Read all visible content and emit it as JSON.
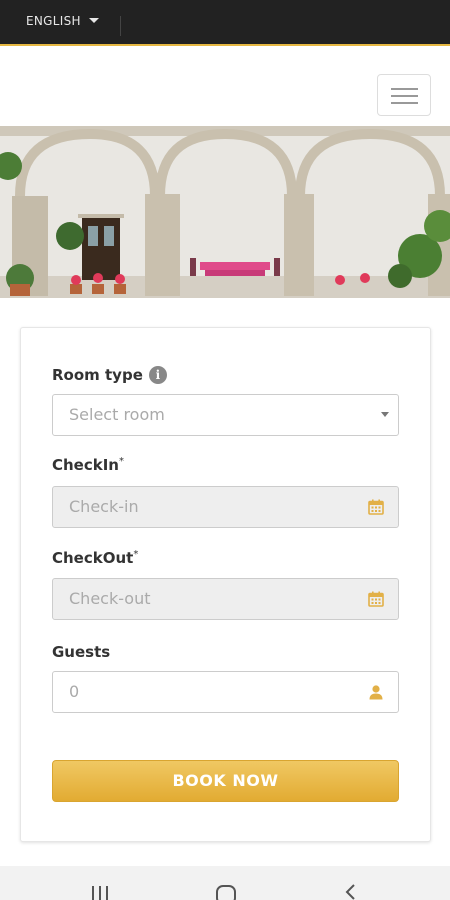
{
  "topbar": {
    "language": "ENGLISH"
  },
  "form": {
    "room_type_label": "Room type",
    "room_type_info_icon": "info-icon",
    "room_type_placeholder": "Select room",
    "checkin_label": "CheckIn",
    "checkin_required": "*",
    "checkin_placeholder": "Check-in",
    "checkout_label": "CheckOut",
    "checkout_required": "*",
    "checkout_placeholder": "Check-out",
    "guests_label": "Guests",
    "guests_value": "0",
    "book_button": "BOOK NOW"
  },
  "icons": {
    "calendar": "calendar-icon",
    "guest": "user-icon",
    "menu": "hamburger-menu-icon"
  },
  "colors": {
    "accent": "#e6b843",
    "topbar": "#222222",
    "button": "#e8b84a"
  }
}
